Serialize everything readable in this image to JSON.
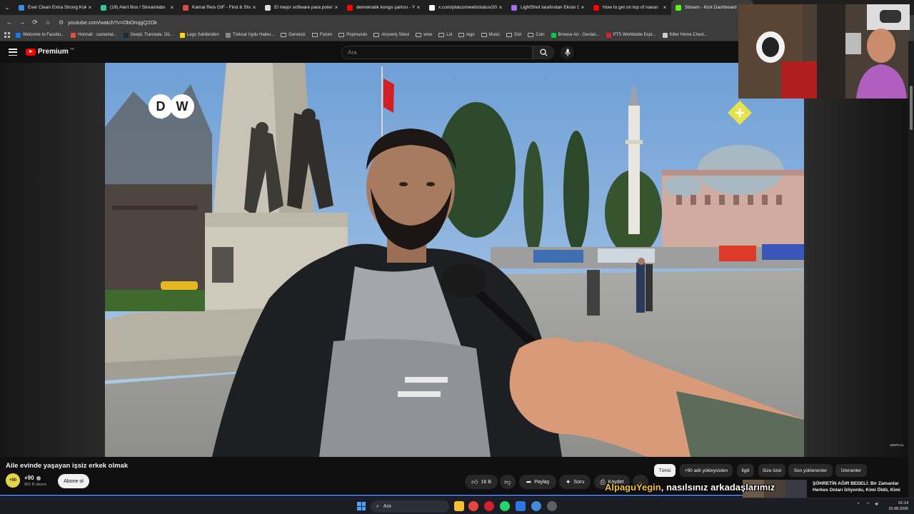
{
  "browser": {
    "tabs": [
      {
        "title": "Ever Clean Extra Strong Kokus",
        "color": "#3a8de0",
        "active": false
      },
      {
        "title": "(19) Alert Box / Streamlabs",
        "color": "#31c4a0",
        "active": false
      },
      {
        "title": "Kamal Reis GIF - Find & Share",
        "color": "#e24a4a",
        "active": false
      },
      {
        "title": "El mejor software para poten",
        "color": "#dddddd",
        "active": false
      },
      {
        "title": "demokratik kongo şarkısı - Y",
        "color": "#ff0000",
        "active": false
      },
      {
        "title": "x.com/platcomweb/status/20",
        "color": "#ffffff",
        "active": false
      },
      {
        "title": "LightShot tarafından Ekran Gö",
        "color": "#a46cf0",
        "active": false
      },
      {
        "title": "How to get on top of naxon",
        "color": "#ff0000",
        "active": false
      },
      {
        "title": "Stream - Kick Dashboard",
        "color": "#53fc18",
        "active": true
      }
    ],
    "url": "youtube.com/watch?v=ObOrojgQ2Ok",
    "bookmarks": [
      {
        "label": "Welcome to Facebo...",
        "kind": "site",
        "color": "#1877f2"
      },
      {
        "label": "Hotmail - cavlantat...",
        "kind": "site",
        "color": "#e94b3c"
      },
      {
        "label": "DeepL Translate: Dü...",
        "kind": "site",
        "color": "#0f2b46"
      },
      {
        "label": "Lego Sahibinden",
        "kind": "site",
        "color": "#ffd500"
      },
      {
        "label": "Türksat Uydu Haber...",
        "kind": "site",
        "color": "#888888"
      },
      {
        "label": "Gereksiz",
        "kind": "folder"
      },
      {
        "label": "Forum",
        "kind": "folder"
      },
      {
        "label": "Popmundo",
        "kind": "folder"
      },
      {
        "label": "Alışveriş Sitesi",
        "kind": "folder"
      },
      {
        "label": "wow",
        "kind": "folder"
      },
      {
        "label": "Lol",
        "kind": "folder"
      },
      {
        "label": "lego",
        "kind": "folder"
      },
      {
        "label": "Music",
        "kind": "folder"
      },
      {
        "label": "Dizi",
        "kind": "folder"
      },
      {
        "label": "Coin",
        "kind": "folder"
      },
      {
        "label": "Browse Art - Devian...",
        "kind": "site",
        "color": "#05cc47"
      },
      {
        "label": "PTS Worldwide Expr...",
        "kind": "site",
        "color": "#d8232a"
      },
      {
        "label": "Killer Home Chest...",
        "kind": "site",
        "color": "#cccccc"
      }
    ]
  },
  "youtube": {
    "logo_text": "Premium",
    "logo_region": "TR",
    "search_placeholder": "Ara",
    "video": {
      "channel_logo": "DW",
      "corner_text": "480P5 DL"
    },
    "info": {
      "title": "Aile evinde yaşayan işsiz erkek olmak",
      "channel": "+90",
      "avatar_text": "+90",
      "subscribers": "902 B abone",
      "subscribe_label": "Abone ol",
      "likes": "16 B",
      "share_label": "Paylaş",
      "ask_label": "Soru",
      "save_label": "Kaydet",
      "more_label": "..."
    },
    "chips": [
      "Tümü",
      "+90 adlı yükleyiciden",
      "İlgili",
      "Size özel",
      "Son yüklenenler",
      "İzlenenler"
    ],
    "recommendation": {
      "title": "ŞÖHRETİN AĞIR BEDELİ: Bir Zamanlar Herkes Onları İzliyordu, Kimi Öldü, Kimi"
    }
  },
  "stream_overlay": {
    "chat_user": "AlpaguYegin",
    "chat_message": "nasılsınız arkadaşlarımız"
  },
  "taskbar": {
    "search_label": "Ara",
    "time": "01:14",
    "date": "22.08.2026"
  },
  "colors": {
    "yt_red": "#ff0000",
    "accent_blue": "#3a6fd8",
    "chat_user": "#f3c23a"
  }
}
